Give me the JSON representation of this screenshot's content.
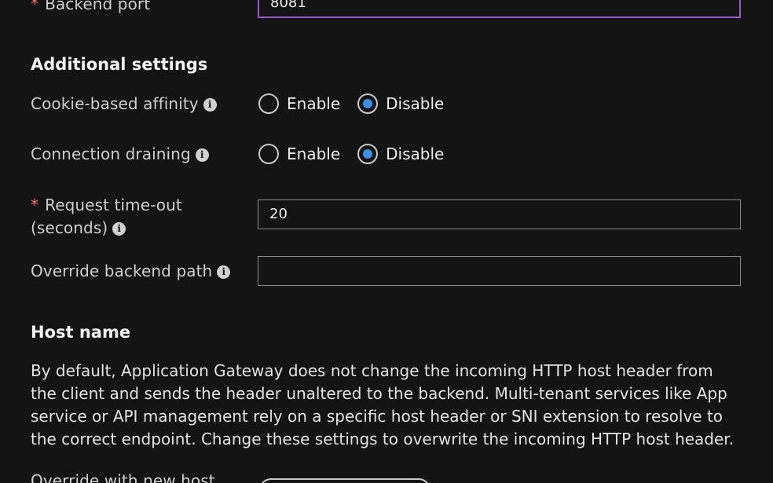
{
  "backend_port": {
    "label": "Backend port",
    "value": "8081"
  },
  "additional_settings": {
    "heading": "Additional settings",
    "cookie_affinity": {
      "label": "Cookie-based affinity",
      "options": [
        "Enable",
        "Disable"
      ],
      "selected": "Disable"
    },
    "connection_draining": {
      "label": "Connection draining",
      "options": [
        "Enable",
        "Disable"
      ],
      "selected": "Disable"
    },
    "request_timeout": {
      "label_line1": "Request time-out",
      "label_line2": "(seconds)",
      "value": "20"
    },
    "override_backend_path": {
      "label": "Override backend path",
      "value": ""
    }
  },
  "host_name": {
    "heading": "Host name",
    "description": "By default, Application Gateway does not change the incoming HTTP host header from the client and sends the header unaltered to the backend. Multi-tenant services like App service or API management rely on a specific host header or SNI extension to resolve to the correct endpoint. Change these settings to overwrite the incoming HTTP host header.",
    "override_label": "Override with new host"
  },
  "colors": {
    "required": "#ff6a6a",
    "focus_border": "#9b59d0",
    "radio_selected": "#3b8eea",
    "valid_check": "#57a64a"
  }
}
